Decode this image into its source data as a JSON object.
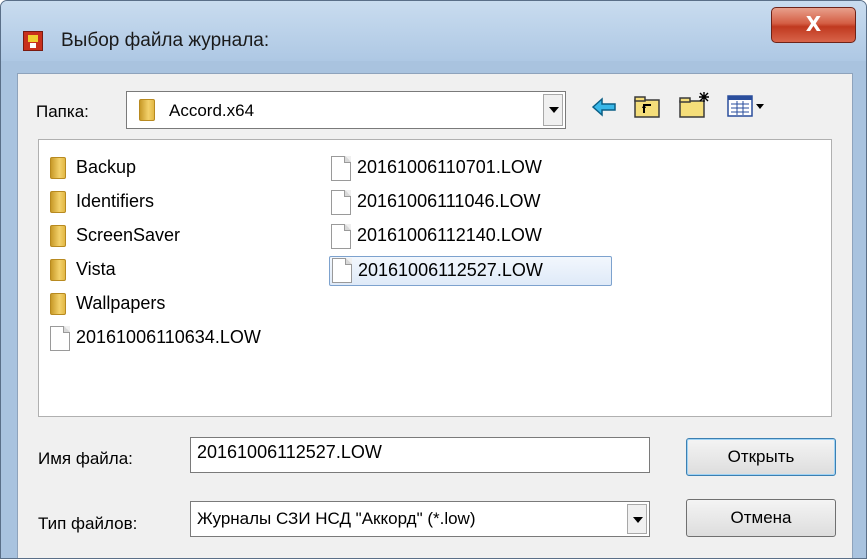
{
  "window": {
    "title": "Выбор файла журнала:",
    "close_glyph": "X"
  },
  "folder_bar": {
    "label": "Папка:",
    "current_folder": "Accord.x64",
    "toolbar_icons": [
      "back-arrow-icon",
      "up-folder-icon",
      "new-folder-icon",
      "view-menu-icon"
    ]
  },
  "files": {
    "column1": [
      {
        "name": "Backup",
        "type": "folder"
      },
      {
        "name": "Identifiers",
        "type": "folder"
      },
      {
        "name": "ScreenSaver",
        "type": "folder"
      },
      {
        "name": "Vista",
        "type": "folder"
      },
      {
        "name": "Wallpapers",
        "type": "folder"
      },
      {
        "name": "20161006110634.LOW",
        "type": "file"
      }
    ],
    "column2": [
      {
        "name": "20161006110701.LOW",
        "type": "file"
      },
      {
        "name": "20161006111046.LOW",
        "type": "file"
      },
      {
        "name": "20161006112140.LOW",
        "type": "file"
      },
      {
        "name": "20161006112527.LOW",
        "type": "file",
        "selected": true
      }
    ]
  },
  "filename": {
    "label": "Имя файла:",
    "value": "20161006112527.LOW"
  },
  "filetype": {
    "label": "Тип файлов:",
    "value": "Журналы СЗИ НСД \"Аккорд\" (*.low)"
  },
  "buttons": {
    "open": "Открыть",
    "cancel": "Отмена"
  }
}
